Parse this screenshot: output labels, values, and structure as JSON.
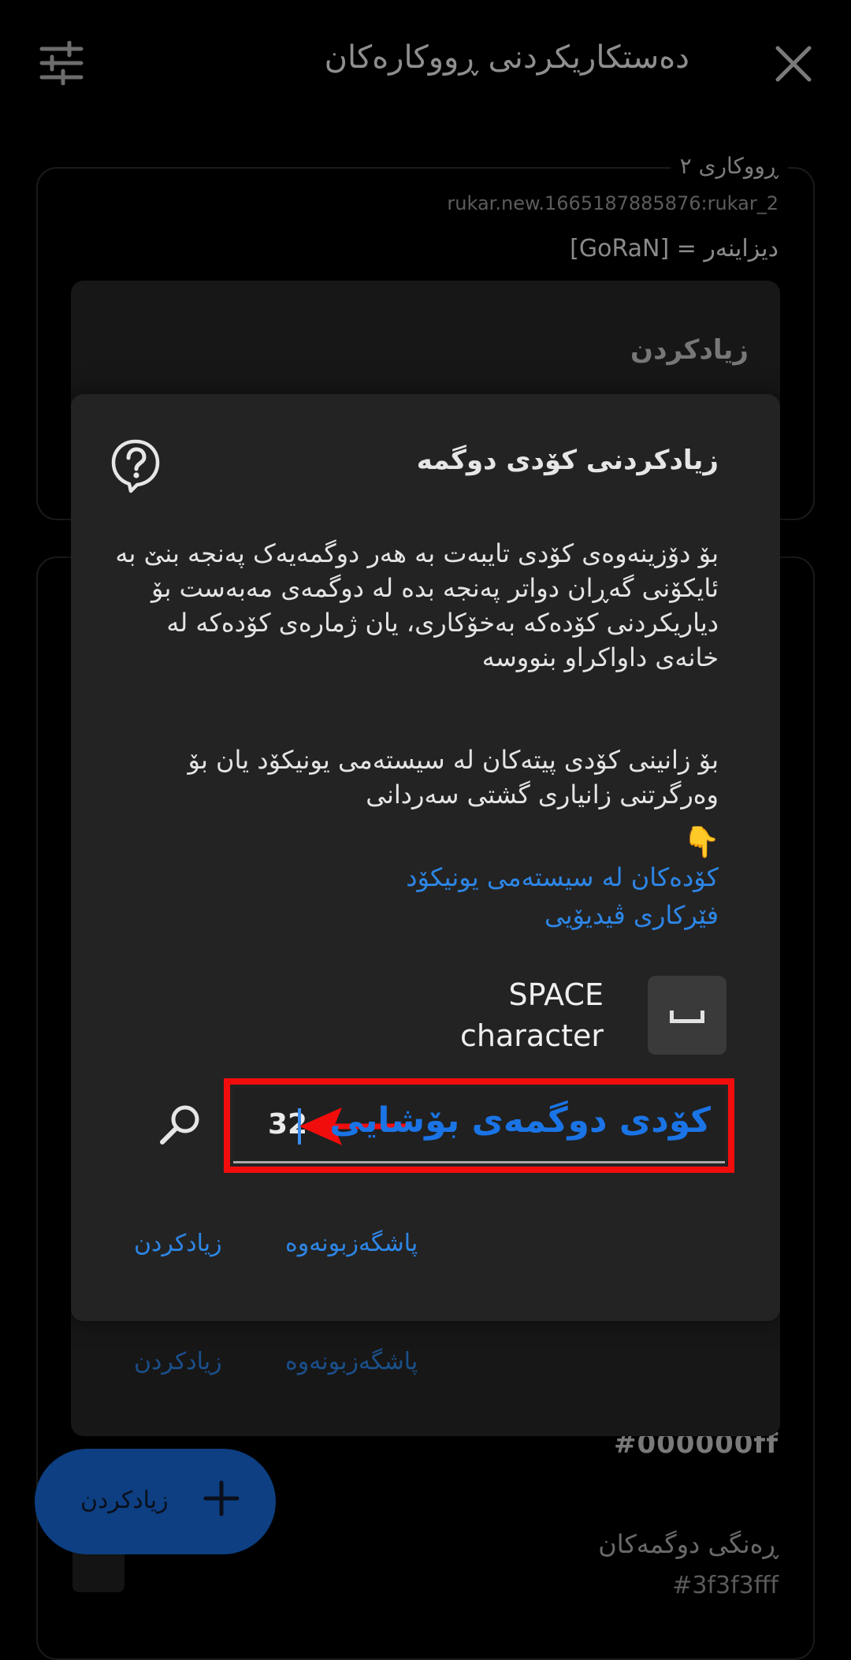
{
  "topbar": {
    "title": "دەستکاریکردنی ڕووکارەکان",
    "filter_icon": "sliders-icon",
    "close_icon": "close-icon"
  },
  "background": {
    "card_title": "ڕووکاری ٢",
    "card_id": "rukar.new.1665187885876:rukar_2",
    "designer_line": "دیزاینەر = [GoRaN]",
    "hex_color": "#000000ff",
    "key_colors_label": "ڕەنگی دوگمەکان",
    "hex_color_2": "#3f3f3fff"
  },
  "dialog1": {
    "title": "زیادکردن",
    "reset_label": "پاشگەزبونەوە",
    "add_label": "زیادکردن"
  },
  "dialog2": {
    "title": "زیادکردنی کۆدی دوگمە",
    "help_icon": "help-bubble-icon",
    "para1": "بۆ دۆزینەوەی کۆدی تایبەت بە هەر دوگمەیەک پەنجە بنێ بە ئایکۆنی گەڕان دواتر پەنجە بدە لە دوگمەی مەبەست بۆ دیاریکردنی کۆدەکە بەخۆکاری، یان ژمارەی کۆدەکە لە خانەی داواکراو بنووسە",
    "para2": "بۆ زانینی کۆدی پیتەکان لە سیستەمی یونیکۆد یان بۆ وەرگرتنی زانیاری گشتی سەردانی",
    "pointer_emoji": "👇",
    "link1": "کۆدەکان لە سیستەمی یونیکۆد",
    "link2": "فێرکاری ڤیدیۆیی",
    "char_name_line1": "SPACE",
    "char_name_line2": "character",
    "char_icon": "space-key-icon",
    "input_value": "32",
    "annotation": "کۆدی دوگمەی بۆشایی",
    "search_icon": "search-icon",
    "reset_label": "پاشگەزبونەوە",
    "add_label": "زیادکردن"
  },
  "fab": {
    "label": "زیادکردن",
    "icon": "plus-icon"
  },
  "colors": {
    "accent": "#2d86e6",
    "annotation_red": "#f20d0d",
    "annotation_blue": "#1a74e6",
    "dialog_bg": "#232323",
    "fab_bg": "#0d3f82"
  }
}
